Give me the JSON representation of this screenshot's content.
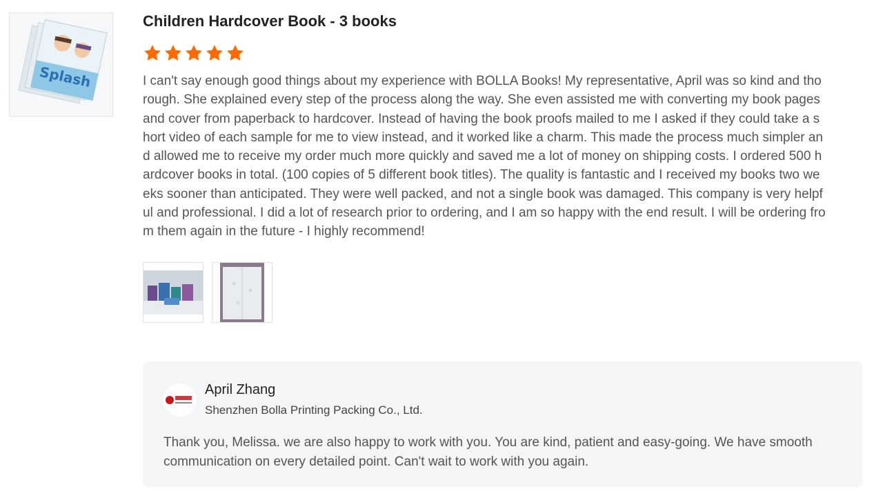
{
  "product": {
    "thumbnail_alt": "Children hardcover book cover"
  },
  "review": {
    "title": "Children Hardcover Book - 3 books",
    "rating": 5,
    "rating_max": 5,
    "star_color": "#ff6a00",
    "text": "I can't say enough good things about my experience with BOLLA Books! My representative, April was so kind and thorough. She explained every step of the process along the way. She even assisted me with converting my book pages and cover from paperback to hardcover. Instead of having the book proofs mailed to me I asked if they could take a short video of each sample for me to view instead, and it worked like a charm. This made the process much simpler and allowed me to receive my order much more quickly and saved me a lot of money on shipping costs. I ordered 500 hardcover books in total. (100 copies of 5 different book titles). The quality is fantastic and I received my books two weeks sooner than anticipated. They were well packed, and not a single book was damaged. This company is very helpful and professional. I did a lot of research prior to ordering, and I am so happy with the end result. I will be ordering from them again in the future - I highly recommend!"
  },
  "reply": {
    "name": "April Zhang",
    "company": "Shenzhen Bolla Printing Packing Co., Ltd.",
    "text": "Thank you, Melissa. we are also happy to work with you. You are kind, patient and easy-going. We have smooth communication on every detailed point. Can't wait to work with you again."
  }
}
